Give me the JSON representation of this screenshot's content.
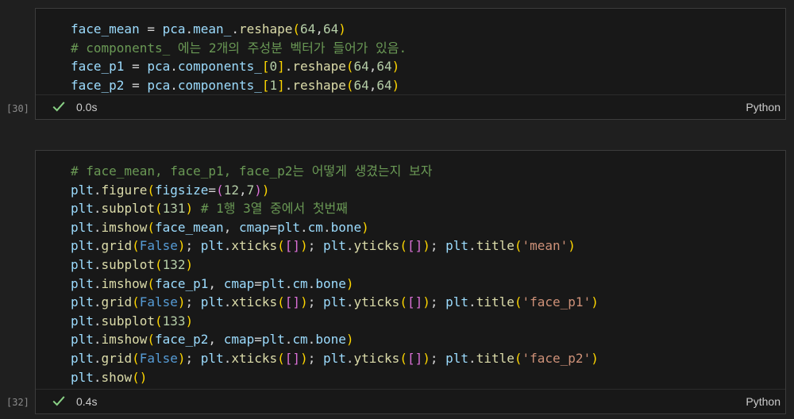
{
  "cells": [
    {
      "exec_count": "[30]",
      "timing": "0.0s",
      "language": "Python",
      "lines": [
        [
          [
            "v",
            "face_mean"
          ],
          [
            "op",
            " = "
          ],
          [
            "v",
            "pca"
          ],
          [
            "op",
            "."
          ],
          [
            "v",
            "mean_"
          ],
          [
            "op",
            "."
          ],
          [
            "fn",
            "reshape"
          ],
          [
            "p1",
            "("
          ],
          [
            "num",
            "64"
          ],
          [
            "op",
            ","
          ],
          [
            "num",
            "64"
          ],
          [
            "p1",
            ")"
          ]
        ],
        [
          [
            "cm",
            "# components_ 에는 2개의 주성분 벡터가 들어가 있음."
          ]
        ],
        [
          [
            "v",
            "face_p1"
          ],
          [
            "op",
            " = "
          ],
          [
            "v",
            "pca"
          ],
          [
            "op",
            "."
          ],
          [
            "v",
            "components_"
          ],
          [
            "p1",
            "["
          ],
          [
            "num",
            "0"
          ],
          [
            "p1",
            "]"
          ],
          [
            "op",
            "."
          ],
          [
            "fn",
            "reshape"
          ],
          [
            "p1",
            "("
          ],
          [
            "num",
            "64"
          ],
          [
            "op",
            ","
          ],
          [
            "num",
            "64"
          ],
          [
            "p1",
            ")"
          ]
        ],
        [
          [
            "v",
            "face_p2"
          ],
          [
            "op",
            " = "
          ],
          [
            "v",
            "pca"
          ],
          [
            "op",
            "."
          ],
          [
            "v",
            "components_"
          ],
          [
            "p1",
            "["
          ],
          [
            "num",
            "1"
          ],
          [
            "p1",
            "]"
          ],
          [
            "op",
            "."
          ],
          [
            "fn",
            "reshape"
          ],
          [
            "p1",
            "("
          ],
          [
            "num",
            "64"
          ],
          [
            "op",
            ","
          ],
          [
            "num",
            "64"
          ],
          [
            "p1",
            ")"
          ]
        ]
      ]
    },
    {
      "exec_count": "[32]",
      "timing": "0.4s",
      "language": "Python",
      "lines": [
        [
          [
            "cm",
            "# face_mean, face_p1, face_p2는 어떻게 생겼는지 보자"
          ]
        ],
        [
          [
            "v",
            "plt"
          ],
          [
            "op",
            "."
          ],
          [
            "fn",
            "figure"
          ],
          [
            "p1",
            "("
          ],
          [
            "v",
            "figsize"
          ],
          [
            "op",
            "="
          ],
          [
            "p2",
            "("
          ],
          [
            "num",
            "12"
          ],
          [
            "op",
            ","
          ],
          [
            "num",
            "7"
          ],
          [
            "p2",
            ")"
          ],
          [
            "p1",
            ")"
          ]
        ],
        [
          [
            "v",
            "plt"
          ],
          [
            "op",
            "."
          ],
          [
            "fn",
            "subplot"
          ],
          [
            "p1",
            "("
          ],
          [
            "num",
            "131"
          ],
          [
            "p1",
            ")"
          ],
          [
            "op",
            " "
          ],
          [
            "cm",
            "# 1행 3열 중에서 첫번째"
          ]
        ],
        [
          [
            "v",
            "plt"
          ],
          [
            "op",
            "."
          ],
          [
            "fn",
            "imshow"
          ],
          [
            "p1",
            "("
          ],
          [
            "v",
            "face_mean"
          ],
          [
            "op",
            ", "
          ],
          [
            "v",
            "cmap"
          ],
          [
            "op",
            "="
          ],
          [
            "v",
            "plt"
          ],
          [
            "op",
            "."
          ],
          [
            "v",
            "cm"
          ],
          [
            "op",
            "."
          ],
          [
            "v",
            "bone"
          ],
          [
            "p1",
            ")"
          ]
        ],
        [
          [
            "v",
            "plt"
          ],
          [
            "op",
            "."
          ],
          [
            "fn",
            "grid"
          ],
          [
            "p1",
            "("
          ],
          [
            "kw",
            "False"
          ],
          [
            "p1",
            ")"
          ],
          [
            "op",
            "; "
          ],
          [
            "v",
            "plt"
          ],
          [
            "op",
            "."
          ],
          [
            "fn",
            "xticks"
          ],
          [
            "p1",
            "("
          ],
          [
            "p2",
            "["
          ],
          [
            "p2",
            "]"
          ],
          [
            "p1",
            ")"
          ],
          [
            "op",
            "; "
          ],
          [
            "v",
            "plt"
          ],
          [
            "op",
            "."
          ],
          [
            "fn",
            "yticks"
          ],
          [
            "p1",
            "("
          ],
          [
            "p2",
            "["
          ],
          [
            "p2",
            "]"
          ],
          [
            "p1",
            ")"
          ],
          [
            "op",
            "; "
          ],
          [
            "v",
            "plt"
          ],
          [
            "op",
            "."
          ],
          [
            "fn",
            "title"
          ],
          [
            "p1",
            "("
          ],
          [
            "str",
            "'mean'"
          ],
          [
            "p1",
            ")"
          ]
        ],
        [
          [
            "v",
            "plt"
          ],
          [
            "op",
            "."
          ],
          [
            "fn",
            "subplot"
          ],
          [
            "p1",
            "("
          ],
          [
            "num",
            "132"
          ],
          [
            "p1",
            ")"
          ]
        ],
        [
          [
            "v",
            "plt"
          ],
          [
            "op",
            "."
          ],
          [
            "fn",
            "imshow"
          ],
          [
            "p1",
            "("
          ],
          [
            "v",
            "face_p1"
          ],
          [
            "op",
            ", "
          ],
          [
            "v",
            "cmap"
          ],
          [
            "op",
            "="
          ],
          [
            "v",
            "plt"
          ],
          [
            "op",
            "."
          ],
          [
            "v",
            "cm"
          ],
          [
            "op",
            "."
          ],
          [
            "v",
            "bone"
          ],
          [
            "p1",
            ")"
          ]
        ],
        [
          [
            "v",
            "plt"
          ],
          [
            "op",
            "."
          ],
          [
            "fn",
            "grid"
          ],
          [
            "p1",
            "("
          ],
          [
            "kw",
            "False"
          ],
          [
            "p1",
            ")"
          ],
          [
            "op",
            "; "
          ],
          [
            "v",
            "plt"
          ],
          [
            "op",
            "."
          ],
          [
            "fn",
            "xticks"
          ],
          [
            "p1",
            "("
          ],
          [
            "p2",
            "["
          ],
          [
            "p2",
            "]"
          ],
          [
            "p1",
            ")"
          ],
          [
            "op",
            "; "
          ],
          [
            "v",
            "plt"
          ],
          [
            "op",
            "."
          ],
          [
            "fn",
            "yticks"
          ],
          [
            "p1",
            "("
          ],
          [
            "p2",
            "["
          ],
          [
            "p2",
            "]"
          ],
          [
            "p1",
            ")"
          ],
          [
            "op",
            "; "
          ],
          [
            "v",
            "plt"
          ],
          [
            "op",
            "."
          ],
          [
            "fn",
            "title"
          ],
          [
            "p1",
            "("
          ],
          [
            "str",
            "'face_p1'"
          ],
          [
            "p1",
            ")"
          ]
        ],
        [
          [
            "v",
            "plt"
          ],
          [
            "op",
            "."
          ],
          [
            "fn",
            "subplot"
          ],
          [
            "p1",
            "("
          ],
          [
            "num",
            "133"
          ],
          [
            "p1",
            ")"
          ]
        ],
        [
          [
            "v",
            "plt"
          ],
          [
            "op",
            "."
          ],
          [
            "fn",
            "imshow"
          ],
          [
            "p1",
            "("
          ],
          [
            "v",
            "face_p2"
          ],
          [
            "op",
            ", "
          ],
          [
            "v",
            "cmap"
          ],
          [
            "op",
            "="
          ],
          [
            "v",
            "plt"
          ],
          [
            "op",
            "."
          ],
          [
            "v",
            "cm"
          ],
          [
            "op",
            "."
          ],
          [
            "v",
            "bone"
          ],
          [
            "p1",
            ")"
          ]
        ],
        [
          [
            "v",
            "plt"
          ],
          [
            "op",
            "."
          ],
          [
            "fn",
            "grid"
          ],
          [
            "p1",
            "("
          ],
          [
            "kw",
            "False"
          ],
          [
            "p1",
            ")"
          ],
          [
            "op",
            "; "
          ],
          [
            "v",
            "plt"
          ],
          [
            "op",
            "."
          ],
          [
            "fn",
            "xticks"
          ],
          [
            "p1",
            "("
          ],
          [
            "p2",
            "["
          ],
          [
            "p2",
            "]"
          ],
          [
            "p1",
            ")"
          ],
          [
            "op",
            "; "
          ],
          [
            "v",
            "plt"
          ],
          [
            "op",
            "."
          ],
          [
            "fn",
            "yticks"
          ],
          [
            "p1",
            "("
          ],
          [
            "p2",
            "["
          ],
          [
            "p2",
            "]"
          ],
          [
            "p1",
            ")"
          ],
          [
            "op",
            "; "
          ],
          [
            "v",
            "plt"
          ],
          [
            "op",
            "."
          ],
          [
            "fn",
            "title"
          ],
          [
            "p1",
            "("
          ],
          [
            "str",
            "'face_p2'"
          ],
          [
            "p1",
            ")"
          ]
        ],
        [
          [
            "v",
            "plt"
          ],
          [
            "op",
            "."
          ],
          [
            "fn",
            "show"
          ],
          [
            "p1",
            "("
          ],
          [
            "p1",
            ")"
          ]
        ]
      ]
    }
  ],
  "icons": {
    "status": "check-icon"
  },
  "colors": {
    "check": "#89d185",
    "background": "#1f1f1f",
    "cell_border": "#3c3c3c"
  }
}
